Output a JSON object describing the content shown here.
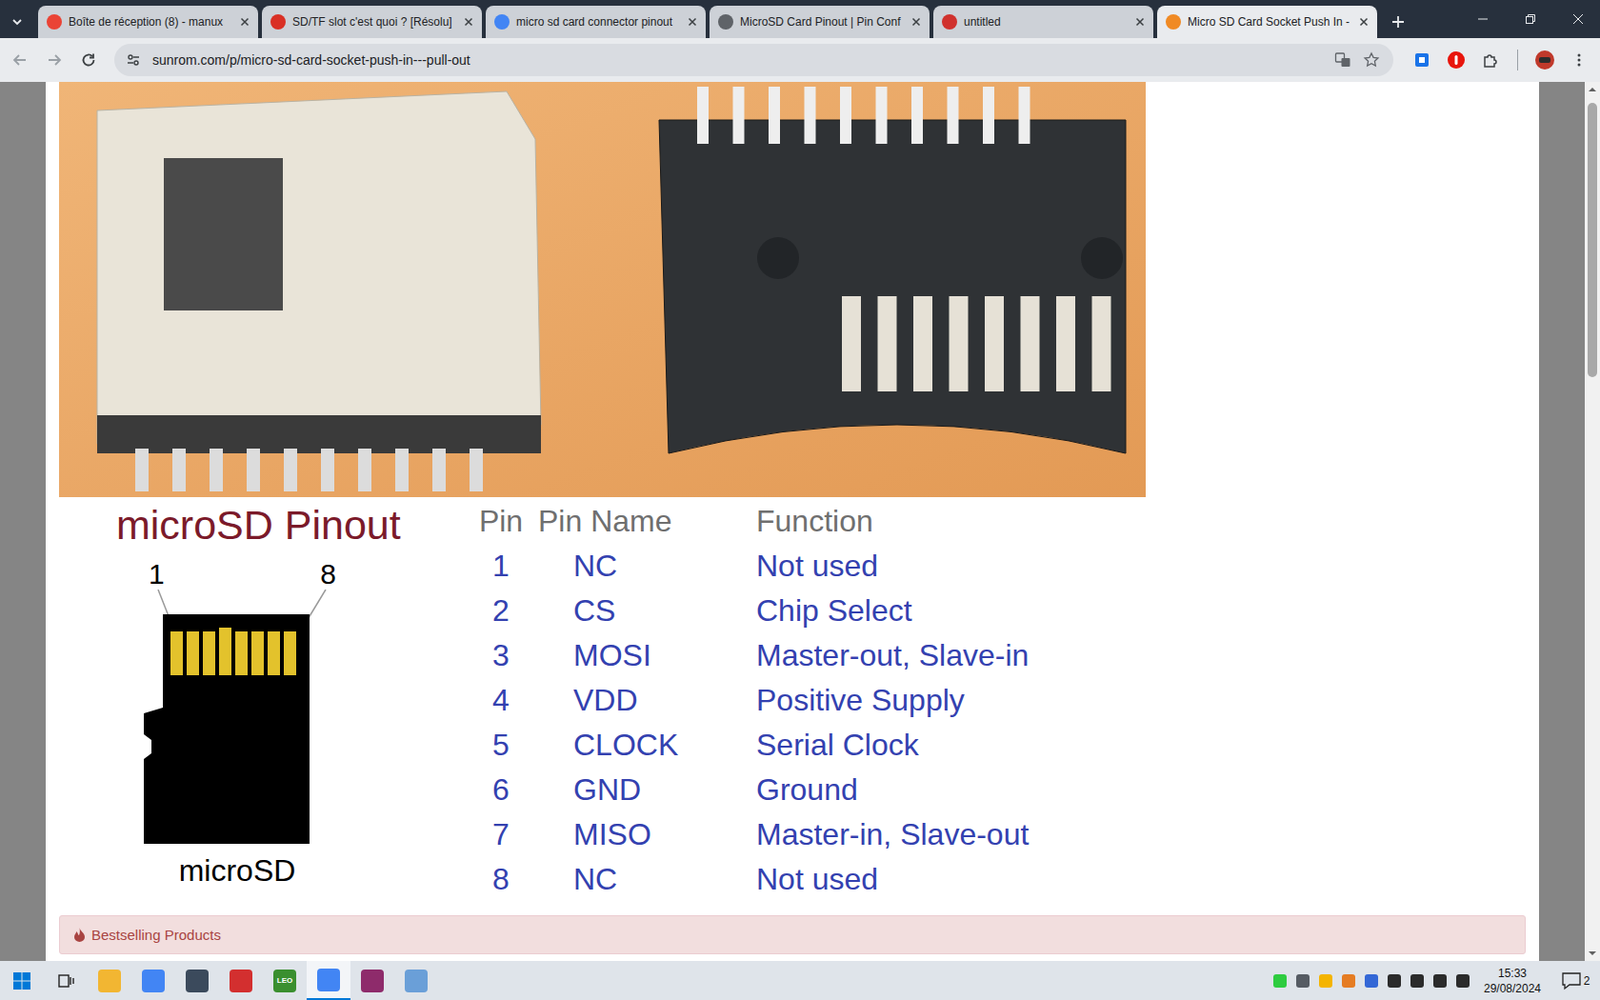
{
  "browser": {
    "tabs": [
      {
        "label": "Boîte de réception (8) - manux",
        "selected": false,
        "color": "#ea4335"
      },
      {
        "label": "SD/TF slot c'est quoi ? [Résolu]",
        "selected": false,
        "color": "#d93025"
      },
      {
        "label": "micro sd card connector pinout",
        "selected": false,
        "color": "#4285f4"
      },
      {
        "label": "MicroSD Card Pinout | Pin Conf",
        "selected": false,
        "color": "#5f6368"
      },
      {
        "label": "untitled",
        "selected": false,
        "color": "#d0312d"
      },
      {
        "label": "Micro SD Card Socket Push In -",
        "selected": true,
        "color": "#f08a24"
      }
    ],
    "address": "sunrom.com/p/micro-sd-card-socket-push-in---pull-out",
    "scrollbar": {
      "offset": 0.36,
      "size": 0.324
    }
  },
  "page": {
    "pinout": {
      "title": "microSD Pinout",
      "card_labels": [
        "1",
        "8"
      ],
      "card_caption": "microSD",
      "columns": [
        "Pin",
        "Pin Name",
        "Function"
      ],
      "rows": [
        {
          "pin": "1",
          "name": "NC",
          "function": "Not used"
        },
        {
          "pin": "2",
          "name": "CS",
          "function": "Chip Select"
        },
        {
          "pin": "3",
          "name": "MOSI",
          "function": "Master-out, Slave-in"
        },
        {
          "pin": "4",
          "name": "VDD",
          "function": "Positive Supply"
        },
        {
          "pin": "5",
          "name": "CLOCK",
          "function": "Serial Clock"
        },
        {
          "pin": "6",
          "name": "GND",
          "function": "Ground"
        },
        {
          "pin": "7",
          "name": "MISO",
          "function": "Master-in, Slave-out"
        },
        {
          "pin": "8",
          "name": "NC",
          "function": "Not used"
        }
      ]
    },
    "bestselling": {
      "label": "Bestselling Products"
    }
  },
  "taskbar": {
    "apps": [
      {
        "color": "#f2b632",
        "selected": false,
        "label": ""
      },
      {
        "color": "#4285f4",
        "selected": false,
        "label": ""
      },
      {
        "color": "#3b4a5c",
        "selected": false,
        "label": ""
      },
      {
        "color": "#d32f2f",
        "selected": false,
        "label": ""
      },
      {
        "color": "#3a8f2f",
        "selected": false,
        "label": "LEO"
      },
      {
        "color": "#4285f4",
        "selected": true,
        "label": ""
      },
      {
        "color": "#8e2b6b",
        "selected": false,
        "label": ""
      },
      {
        "color": "#6a9fd8",
        "selected": false,
        "label": ""
      }
    ],
    "tray": [
      {
        "color": "#2ecc40"
      },
      {
        "color": "#555b63"
      },
      {
        "color": "#f4b400"
      },
      {
        "color": "#e57c23"
      },
      {
        "color": "#3367d6"
      },
      {
        "color": "#2b2b2b"
      },
      {
        "color": "#2b2b2b"
      },
      {
        "color": "#2b2b2b"
      },
      {
        "color": "#2b2b2b"
      }
    ],
    "time": "15:33",
    "date": "29/08/2024",
    "notifications": "2"
  }
}
